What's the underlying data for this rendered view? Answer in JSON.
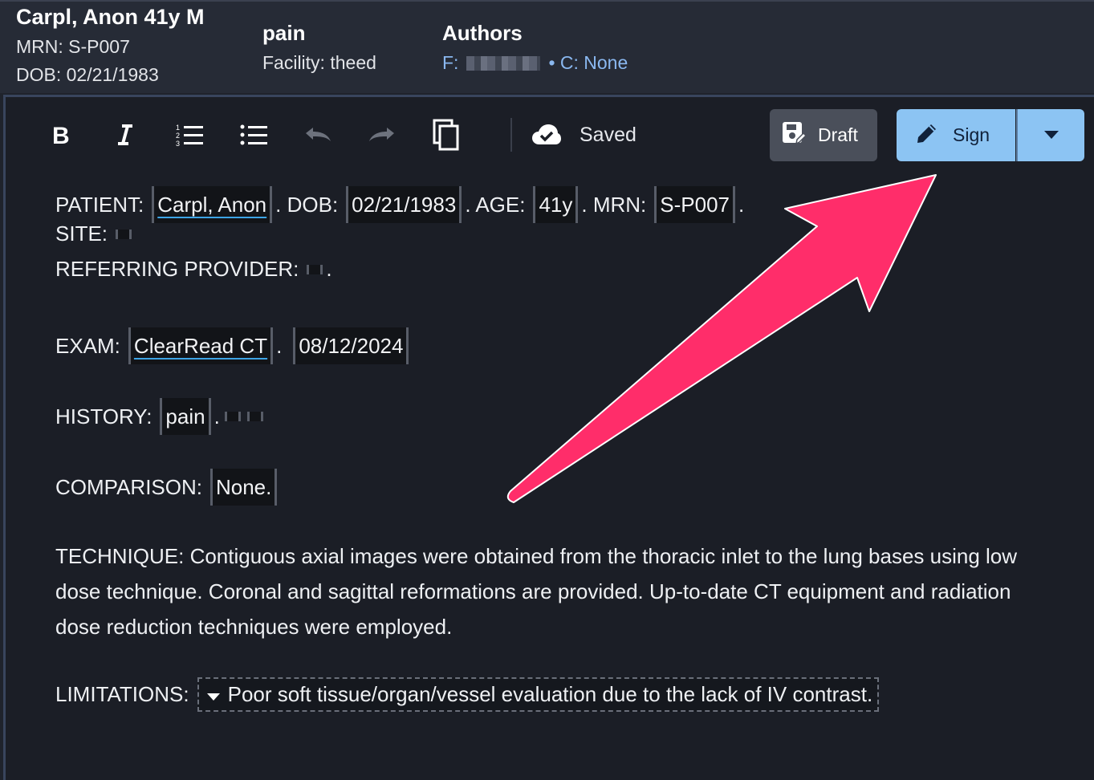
{
  "header": {
    "patient": {
      "name": "Carpl, Anon 41y M",
      "mrn": "MRN: S-P007",
      "dob": "DOB: 02/21/1983"
    },
    "study": {
      "history": "pain",
      "facility": "Facility: theed"
    },
    "authors": {
      "title": "Authors",
      "f_prefix": "F:",
      "c_text": "• C: None"
    }
  },
  "toolbar": {
    "icons": [
      "bold-icon",
      "italic-icon",
      "numbered-list-icon",
      "bulleted-list-icon",
      "undo-icon",
      "redo-icon",
      "copy-icon",
      "cloud-check-icon"
    ],
    "saved_label": "Saved",
    "draft_label": "Draft",
    "sign_label": "Sign",
    "sign_color": "#8cc4f3"
  },
  "report": {
    "patient_line": {
      "label_patient": "PATIENT:",
      "patient": "Carpl, Anon",
      "label_dob": ". DOB:",
      "dob": "02/21/1983",
      "label_age": ". AGE:",
      "age": "41y",
      "label_mrn": ". MRN:",
      "mrn": "S-P007",
      "end": "."
    },
    "site_label": "SITE:",
    "referring_label": "REFERRING PROVIDER:",
    "referring_end": ".",
    "exam_label": "EXAM:",
    "exam": "ClearRead CT",
    "exam_sep": ".",
    "exam_date": "08/12/2024",
    "history_label": "HISTORY:",
    "history": "pain",
    "history_sep": ".",
    "comparison_label": "COMPARISON:",
    "comparison": "None.",
    "technique": "TECHNIQUE: Contiguous axial images were obtained from the thoracic inlet to the lung bases using low dose technique. Coronal and sagittal reformations are provided. Up-to-date CT equipment and radiation dose reduction techniques were employed.",
    "limitations_label": "LIMITATIONS:",
    "limitations": "Poor soft tissue/organ/vessel evaluation due to the lack of IV contrast."
  },
  "annotation": {
    "arrow_color": "#ff2d6a"
  }
}
